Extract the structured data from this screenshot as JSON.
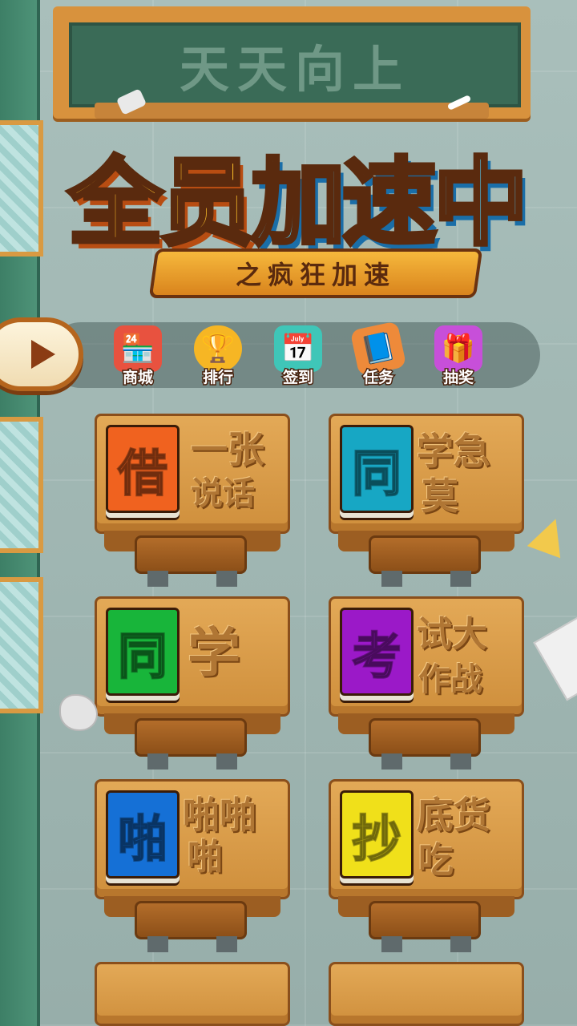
{
  "blackboard": {
    "text": "天天向上"
  },
  "logo": {
    "title_part1": "全员",
    "title_part2": "加速",
    "title_part3": "中",
    "subtitle": "之疯狂加速"
  },
  "toolbar": {
    "items": [
      {
        "label": "商城",
        "icon": "shop-icon",
        "glyph": "🏪"
      },
      {
        "label": "排行",
        "icon": "trophy-icon",
        "glyph": "🏆"
      },
      {
        "label": "签到",
        "icon": "calendar-icon",
        "glyph": "📅"
      },
      {
        "label": "任务",
        "icon": "task-icon",
        "glyph": "📘"
      },
      {
        "label": "抽奖",
        "icon": "gift-icon",
        "glyph": "🎁"
      }
    ]
  },
  "levels": [
    {
      "book_char": "借",
      "book_color": "#f0621f",
      "carved_line1": "一张",
      "carved_line2": "说话"
    },
    {
      "book_char": "同",
      "book_color": "#17a7c4",
      "carved_line1": "学急",
      "carved_line2": "莫"
    },
    {
      "book_char": "同",
      "book_color": "#18b53a",
      "carved_line1": "学",
      "carved_line2": ""
    },
    {
      "book_char": "考",
      "book_color": "#9b19c8",
      "carved_line1": "试大",
      "carved_line2": "作战"
    },
    {
      "book_char": "啪",
      "book_color": "#1570d6",
      "carved_line1": "啪啪",
      "carved_line2": "啪"
    },
    {
      "book_char": "抄",
      "book_color": "#f0e01a",
      "carved_line1": "底货",
      "carved_line2": "吃"
    }
  ]
}
